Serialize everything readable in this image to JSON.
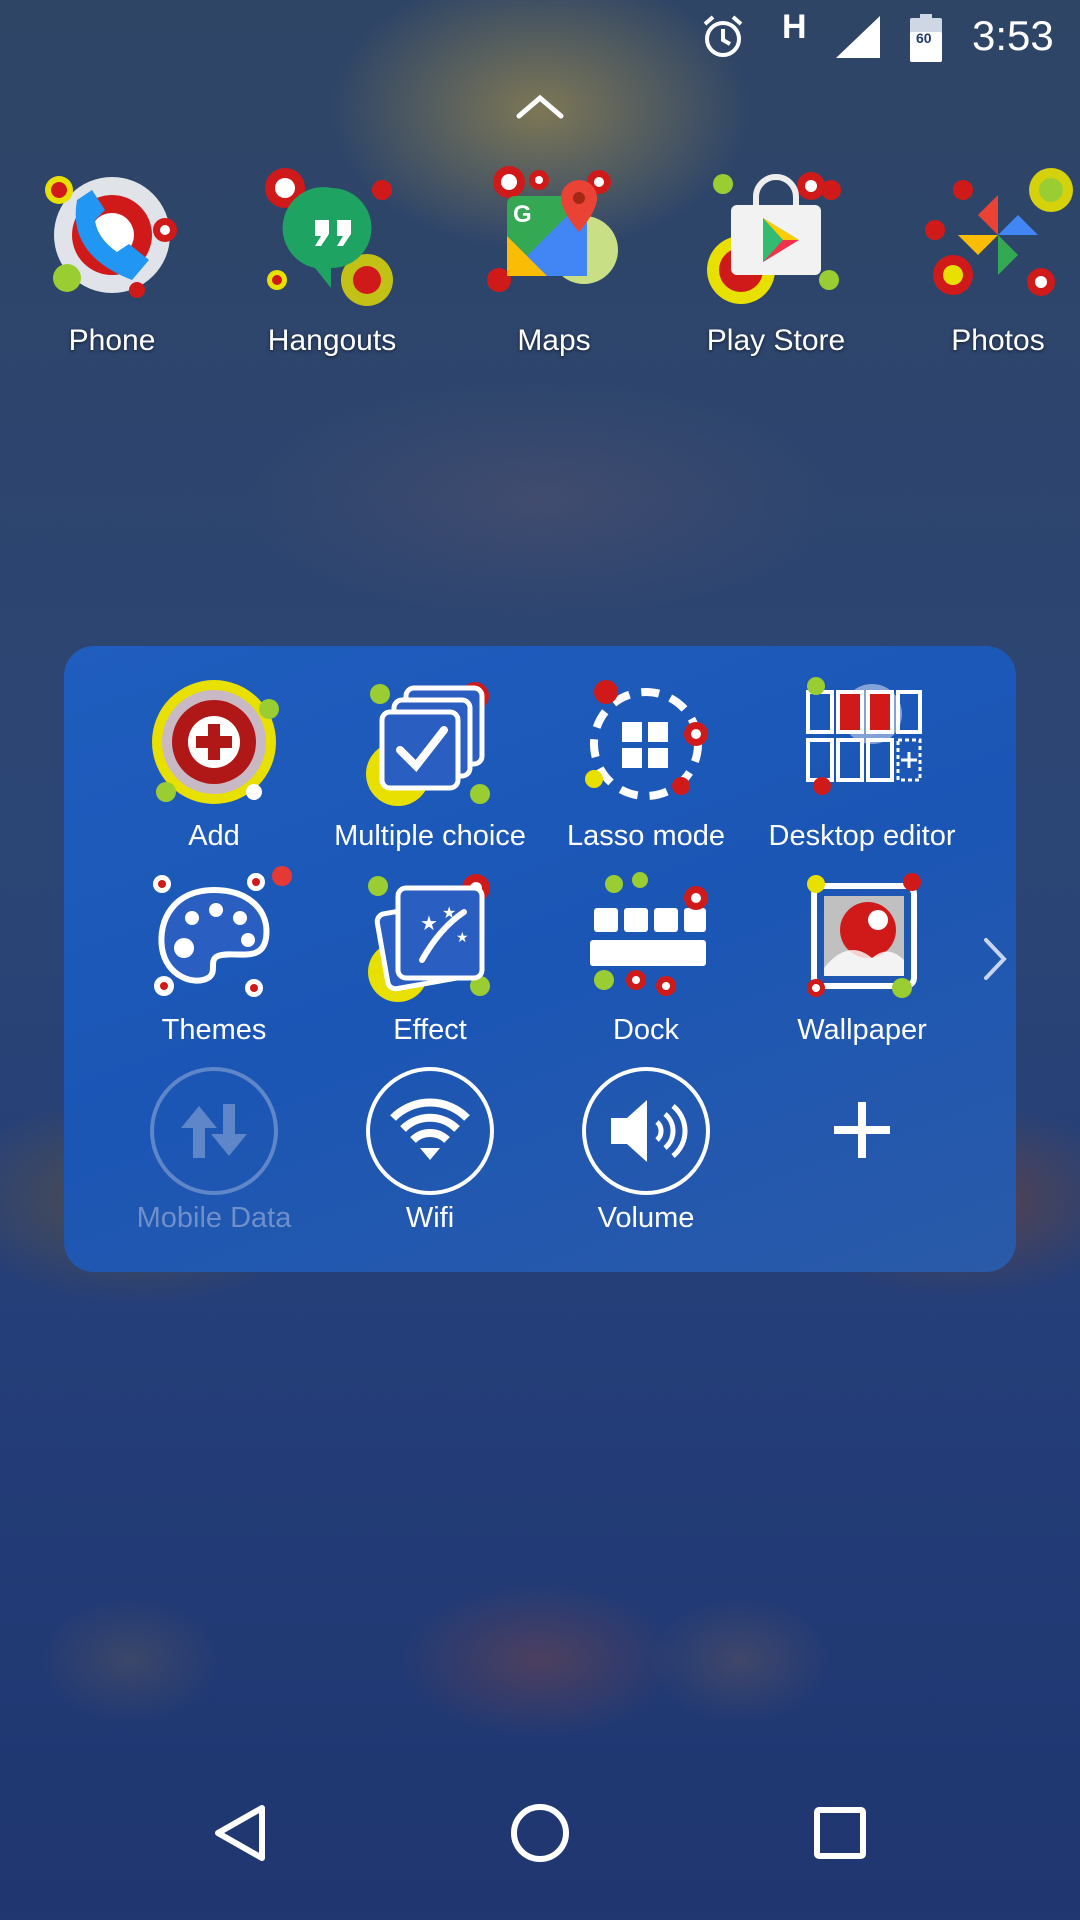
{
  "status_bar": {
    "time": "3:53",
    "network_type": "H",
    "battery_level": "60",
    "icons": [
      "alarm-icon",
      "signal-icon",
      "battery-icon"
    ]
  },
  "dock_apps": [
    {
      "label": "Phone",
      "icon": "phone-icon"
    },
    {
      "label": "Hangouts",
      "icon": "hangouts-icon"
    },
    {
      "label": "Maps",
      "icon": "maps-icon"
    },
    {
      "label": "Play Store",
      "icon": "play-store-icon"
    },
    {
      "label": "Photos",
      "icon": "photos-icon"
    }
  ],
  "panel": {
    "items": [
      {
        "label": "Add",
        "icon": "add-icon"
      },
      {
        "label": "Multiple choice",
        "icon": "multiple-choice-icon"
      },
      {
        "label": "Lasso mode",
        "icon": "lasso-icon"
      },
      {
        "label": "Desktop editor",
        "icon": "desktop-editor-icon"
      },
      {
        "label": "Themes",
        "icon": "palette-icon"
      },
      {
        "label": "Effect",
        "icon": "effect-icon"
      },
      {
        "label": "Dock",
        "icon": "dock-icon"
      },
      {
        "label": "Wallpaper",
        "icon": "wallpaper-icon"
      },
      {
        "label": "Mobile Data",
        "icon": "mobile-data-icon",
        "state": "off"
      },
      {
        "label": "Wifi",
        "icon": "wifi-icon",
        "state": "on"
      },
      {
        "label": "Volume",
        "icon": "volume-icon",
        "state": "on"
      },
      {
        "label": "",
        "icon": "plus-icon"
      }
    ],
    "next_icon": "chevron-right-icon"
  },
  "nav_bar": {
    "buttons": [
      "back-icon",
      "home-icon",
      "recents-icon"
    ]
  },
  "colors": {
    "panel": "#1f5dbe",
    "accent_red": "#d01a1a",
    "accent_yellow": "#e8e000",
    "accent_green": "#9acd32",
    "notification_dot": "#e53935"
  }
}
